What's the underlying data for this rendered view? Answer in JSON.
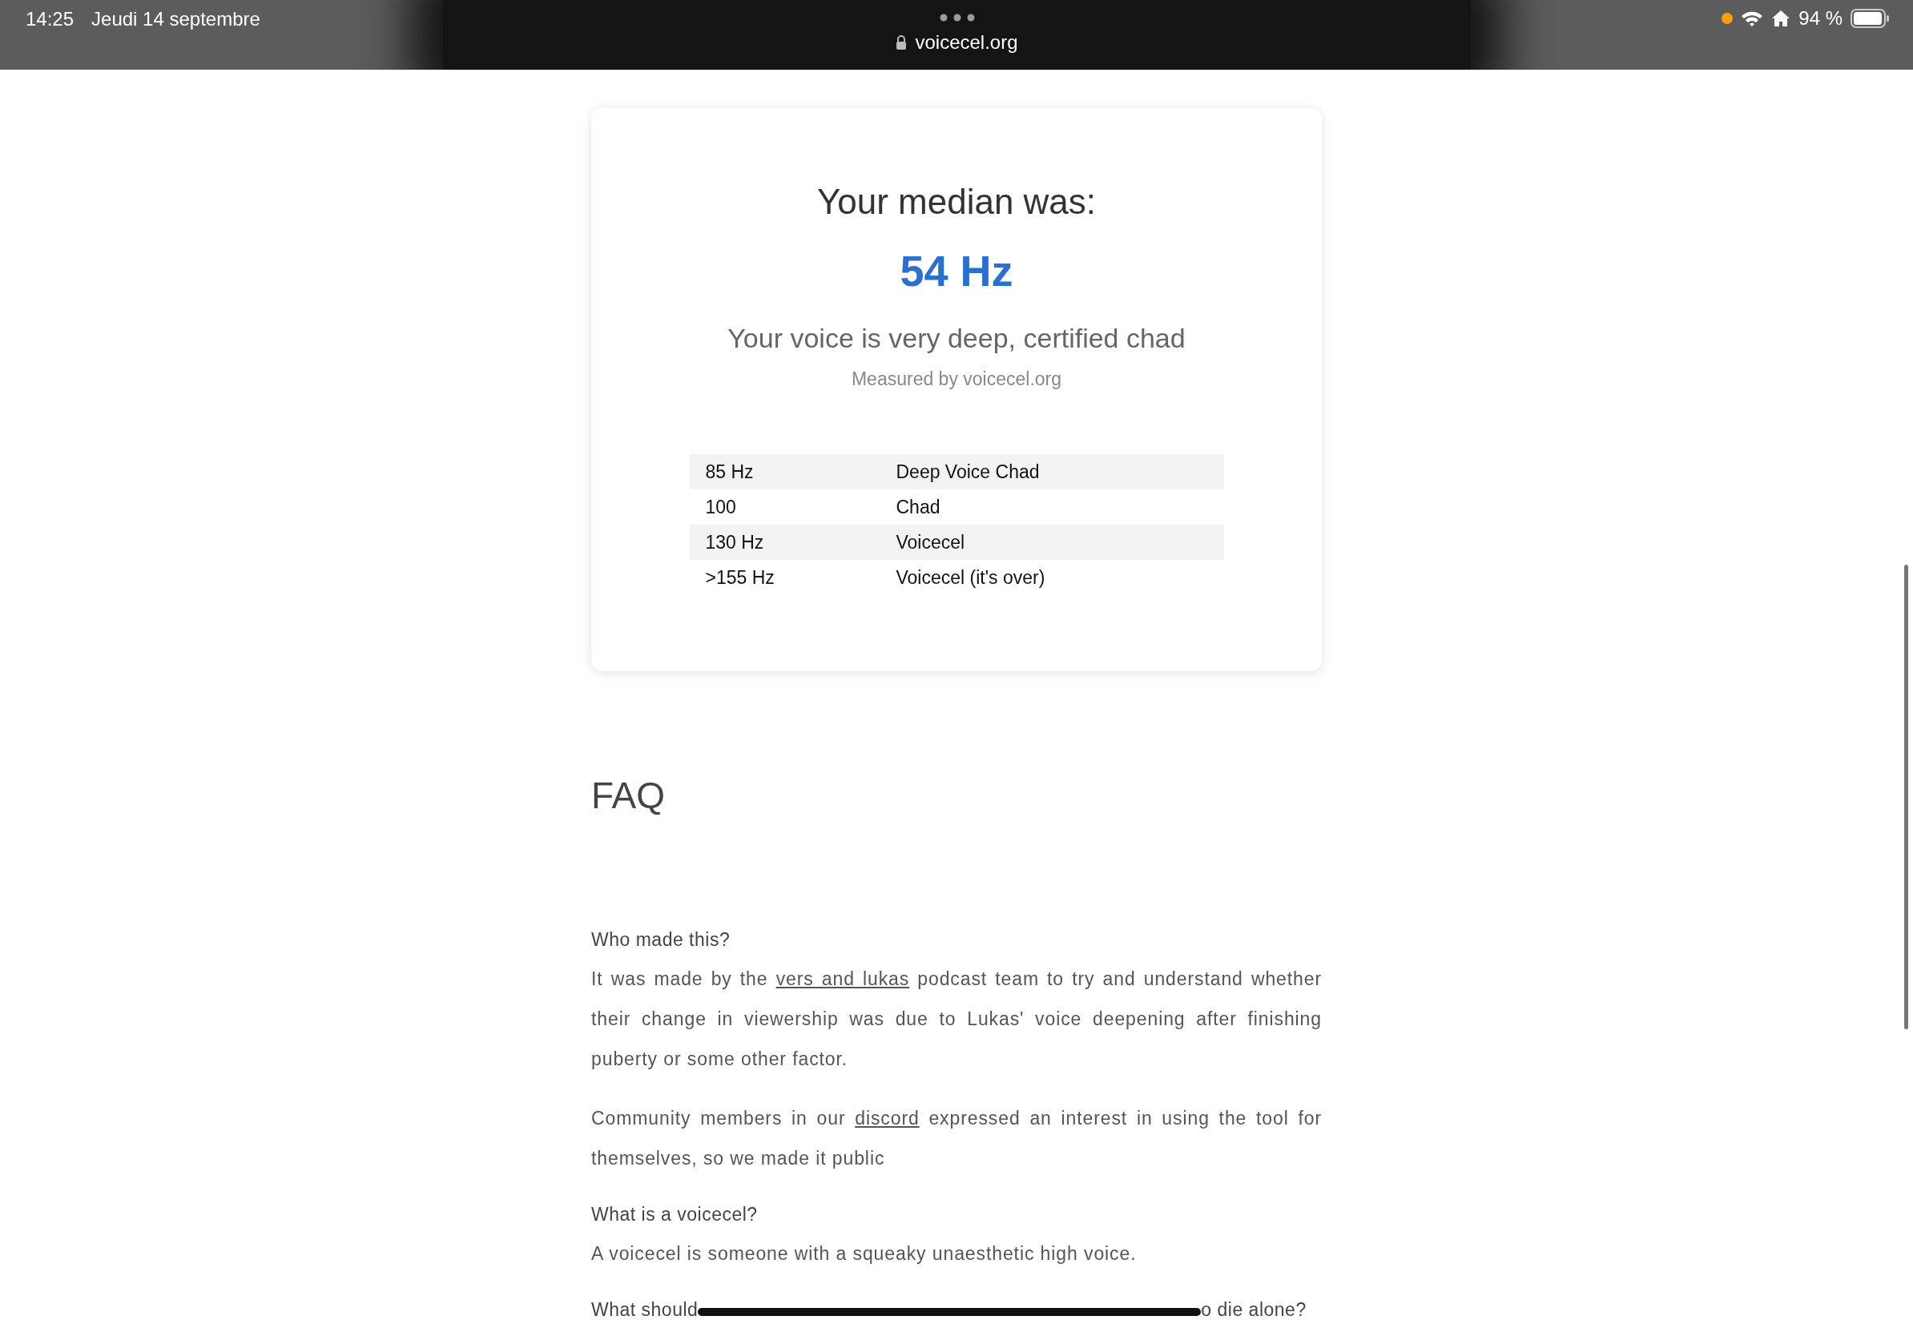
{
  "status_bar": {
    "time": "14:25",
    "date": "Jeudi 14 septembre",
    "url": "voicecel.org",
    "battery": "94 %"
  },
  "result": {
    "heading": "Your median was:",
    "value": "54 Hz",
    "verdict": "Your voice is very deep, certified chad",
    "credit": "Measured by voicecel.org"
  },
  "table": {
    "rows": [
      {
        "frequency": "85 Hz",
        "label": "Deep Voice Chad"
      },
      {
        "frequency": "100",
        "label": "Chad"
      },
      {
        "frequency": "130 Hz",
        "label": "Voicecel"
      },
      {
        "frequency": ">155 Hz",
        "label": "Voicecel (it's over)"
      }
    ]
  },
  "faq": {
    "title": "FAQ",
    "items": [
      {
        "question": "Who made this?",
        "paragraphs": [
          [
            {
              "text": "It was made by the "
            },
            {
              "text": "vers and lukas",
              "link": true
            },
            {
              "text": " podcast team to try and understand whether their change in viewership was due to Lukas' voice deepening after finishing puberty or some other factor."
            }
          ],
          [
            {
              "text": "Community members in our "
            },
            {
              "text": "discord",
              "link": true
            },
            {
              "text": " expressed an interest in using the tool for themselves, so we made it public"
            }
          ]
        ]
      },
      {
        "question": "What is a voicecel?",
        "paragraphs": [
          [
            {
              "text": "A voicecel is someone with a squeaky unaesthetic high voice."
            }
          ]
        ]
      }
    ],
    "last_question": {
      "before": "What should",
      "after": "o die alone?"
    }
  }
}
